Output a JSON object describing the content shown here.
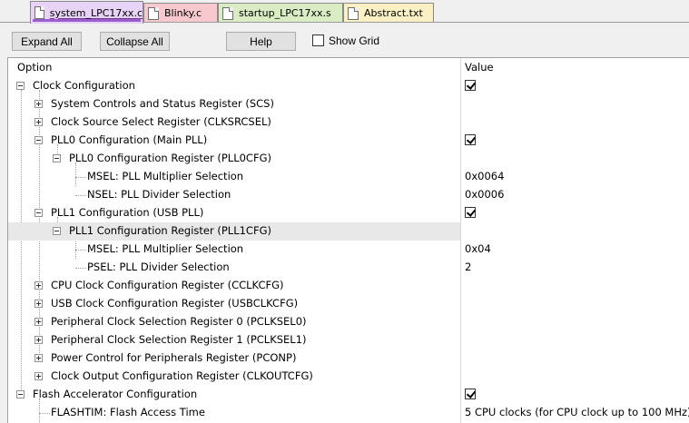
{
  "tabs": [
    {
      "label": "system_LPC17xx.c",
      "color": "#e7d3f5",
      "active": true
    },
    {
      "label": "Blinky.c",
      "color": "#f7c9cf",
      "active": false
    },
    {
      "label": "startup_LPC17xx.s",
      "color": "#d9ecc4",
      "active": false
    },
    {
      "label": "Abstract.txt",
      "color": "#fbf0c4",
      "active": false
    }
  ],
  "toolbar": {
    "expand_all": "Expand All",
    "collapse_all": "Collapse All",
    "help": "Help",
    "show_grid": "Show Grid",
    "show_grid_checked": false
  },
  "grid": {
    "header_option": "Option",
    "header_value": "Value",
    "rows": [
      {
        "label": "Clock Configuration",
        "value_checked": true
      },
      {
        "label": "System Controls and Status Register (SCS)"
      },
      {
        "label": "Clock Source Select Register (CLKSRCSEL)"
      },
      {
        "label": "PLL0 Configuration (Main PLL)",
        "value_checked": true
      },
      {
        "label": "PLL0 Configuration Register (PLL0CFG)"
      },
      {
        "label": "MSEL: PLL Multiplier Selection",
        "value": "0x0064"
      },
      {
        "label": "NSEL: PLL Divider Selection",
        "value": "0x0006"
      },
      {
        "label": "PLL1 Configuration (USB PLL)",
        "value_checked": true
      },
      {
        "label": "PLL1 Configuration Register (PLL1CFG)",
        "selected": true
      },
      {
        "label": "MSEL: PLL Multiplier Selection",
        "value": "0x04"
      },
      {
        "label": "PSEL: PLL Divider Selection",
        "value": "2"
      },
      {
        "label": "CPU Clock Configuration Register (CCLKCFG)"
      },
      {
        "label": "USB Clock Configuration Register (USBCLKCFG)"
      },
      {
        "label": "Peripheral Clock Selection Register 0 (PCLKSEL0)"
      },
      {
        "label": "Peripheral Clock Selection Register 1 (PCLKSEL1)"
      },
      {
        "label": "Power Control for Peripherals Register (PCONP)"
      },
      {
        "label": "Clock Output Configuration Register (CLKOUTCFG)"
      },
      {
        "label": "Flash Accelerator Configuration",
        "value_checked": true
      },
      {
        "label": "FLASHTIM: Flash Access Time",
        "value": "5 CPU clocks (for CPU clock up to 100 MHz)"
      }
    ]
  }
}
